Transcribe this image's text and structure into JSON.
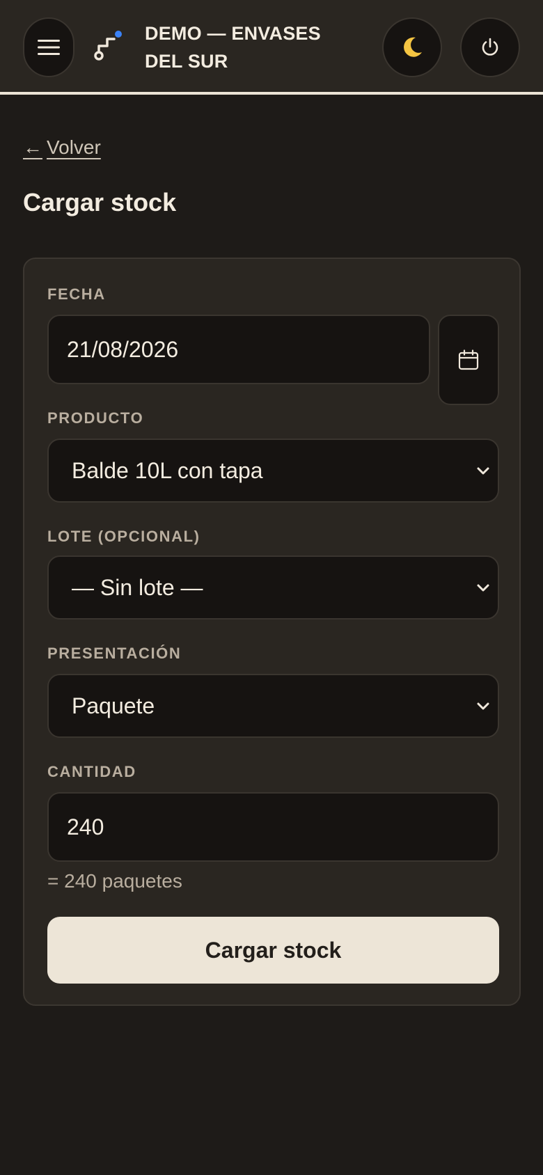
{
  "header": {
    "brand": "DEMO — ENVASES DEL SUR",
    "menu_icon": "menu-icon",
    "theme_icon": "moon-icon",
    "power_icon": "power-icon",
    "logo_icon": "logo-icon"
  },
  "nav": {
    "back_label": "Volver",
    "back_arrow": "←"
  },
  "page": {
    "title": "Cargar stock"
  },
  "form": {
    "fecha": {
      "label": "FECHA",
      "value": "21/08/2026"
    },
    "producto": {
      "label": "PRODUCTO",
      "value": "Balde 10L con tapa"
    },
    "lote": {
      "label": "LOTE (OPCIONAL)",
      "value": "— Sin lote —"
    },
    "presentacion": {
      "label": "PRESENTACIÓN",
      "value": "Paquete"
    },
    "cantidad": {
      "label": "CANTIDAD",
      "value": "240",
      "hint": "= 240 paquetes"
    },
    "submit_label": "Cargar stock"
  },
  "colors": {
    "background": "#1e1b18",
    "surface": "#2a2621",
    "input": "#161311",
    "accent": "#ede5d7",
    "logo_dot": "#3b82f6",
    "moon": "#f5c542"
  }
}
